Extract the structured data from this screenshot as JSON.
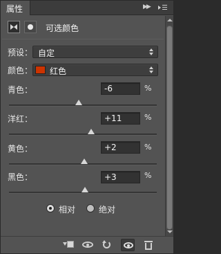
{
  "panel": {
    "tab_label": "属性",
    "title": "可选颜色"
  },
  "preset": {
    "label": "预设：",
    "value": "自定"
  },
  "colors": {
    "label": "颜色：",
    "value": "红色",
    "swatch": "#cc3300"
  },
  "sliders": [
    {
      "label": "青色：",
      "value": "-6",
      "unit": "%"
    },
    {
      "label": "洋红：",
      "value": "+11",
      "unit": "%"
    },
    {
      "label": "黄色：",
      "value": "+2",
      "unit": "%"
    },
    {
      "label": "黑色：",
      "value": "+3",
      "unit": "%"
    }
  ],
  "method": {
    "options": [
      "相对",
      "绝对"
    ],
    "selected": "相对"
  },
  "icons": [
    "collapse-icon",
    "panel-menu-icon",
    "adjustment-mask-icon",
    "layer-mask-icon",
    "clip-to-layer-icon",
    "view-previous-icon",
    "reset-icon",
    "visibility-icon",
    "delete-icon"
  ]
}
